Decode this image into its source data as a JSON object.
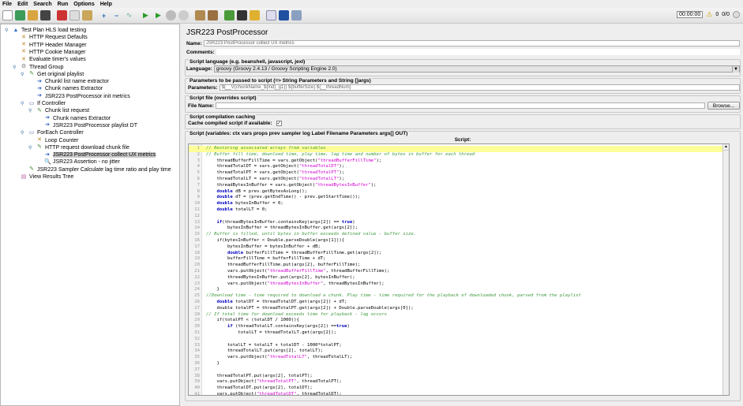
{
  "menu": [
    "File",
    "Edit",
    "Search",
    "Run",
    "Options",
    "Help"
  ],
  "toolbar": [
    "new-icon",
    "templates-icon",
    "open-icon",
    "save-icon",
    "cut-icon",
    "copy-icon",
    "paste-icon",
    "expand-icon",
    "collapse-icon",
    "toggle-icon",
    "start-icon",
    "start-no-pauses-icon",
    "stop-icon",
    "shutdown-icon",
    "clear-icon",
    "clear-all-icon",
    "function-helper-icon",
    "search-icon",
    "reset-search-icon",
    "help-icon",
    "log-viewer-icon",
    "remote-icon"
  ],
  "status": {
    "timer": "00:00:00",
    "warnings": "0",
    "threads": "0/0"
  },
  "tree": [
    {
      "label": "Test Plan HLS load testing",
      "level": 0,
      "icon": "test-plan-icon",
      "toggle": true
    },
    {
      "label": "HTTP Request Defaults",
      "level": 1,
      "icon": "config-icon"
    },
    {
      "label": "HTTP Header Manager",
      "level": 1,
      "icon": "config-icon"
    },
    {
      "label": "HTTP Cookie Manager",
      "level": 1,
      "icon": "config-icon"
    },
    {
      "label": "Evaluate timer's values",
      "level": 1,
      "icon": "config-icon"
    },
    {
      "label": "Thread Group",
      "level": 1,
      "icon": "thread-group-icon",
      "toggle": true
    },
    {
      "label": "Get original playlist",
      "level": 2,
      "icon": "sampler-icon",
      "toggle": true
    },
    {
      "label": "Chunkl list name extractor",
      "level": 3,
      "icon": "postprocessor-icon"
    },
    {
      "label": "Chunk names Extractor",
      "level": 3,
      "icon": "postprocessor-icon"
    },
    {
      "label": "JSR223 PostProcessor init metrics",
      "level": 3,
      "icon": "postprocessor-icon"
    },
    {
      "label": "If Controller",
      "level": 2,
      "icon": "controller-icon",
      "toggle": true
    },
    {
      "label": "Chunk list request",
      "level": 3,
      "icon": "sampler-icon",
      "toggle": true
    },
    {
      "label": "Chunk names Extractor",
      "level": 4,
      "icon": "postprocessor-icon"
    },
    {
      "label": "JSR223 PostProcessor playlist DT",
      "level": 4,
      "icon": "postprocessor-icon"
    },
    {
      "label": "ForEach Controller",
      "level": 2,
      "icon": "controller-icon",
      "toggle": true
    },
    {
      "label": "Loop Counter",
      "level": 3,
      "icon": "config-icon"
    },
    {
      "label": "HTTP request download chunk file",
      "level": 3,
      "icon": "sampler-icon",
      "toggle": true
    },
    {
      "label": "JSR223 PostProcessor collect UX metrics",
      "level": 4,
      "icon": "postprocessor-icon",
      "selected": true
    },
    {
      "label": "JSR223 Assertion - no jitter",
      "level": 4,
      "icon": "assertion-icon"
    },
    {
      "label": "JSR223 Sampler Calculate lag time ratio and play time",
      "level": 2,
      "icon": "sampler-icon"
    },
    {
      "label": "View Results Tree",
      "level": 1,
      "icon": "listener-icon"
    }
  ],
  "panel": {
    "title": "JSR223 PostProcessor",
    "name_label": "Name:",
    "name_value": "JSR223 PostProcessor collect UX metrics",
    "comments_label": "Comments:",
    "lang_group": "Script language (e.g. beanshell, javascript, jexl)",
    "lang_label": "Language:",
    "lang_value": "groovy     (Groovy 2.4.13 / Groovy Scripting Engine 2.0)",
    "params_group": "Parameters to be passed to script (=> String Parameters and String []args)",
    "params_label": "Parameters:",
    "params_value": "${__V(chunkName_${lnd}_g1)} ${bufferSize} ${__threadNum}",
    "file_group": "Script file (overrides script)",
    "file_label": "File Name:",
    "browse": "Browse...",
    "cache_group": "Script compilation caching",
    "cache_label": "Cache compiled script if available:",
    "cache_checked": true,
    "script_group": "Script (variables: ctx vars props prev sampler log Label Filename Parameters args[] OUT)",
    "script_label": "Script:"
  },
  "code": [
    "// Restoring associated arrays from variables",
    "// Buffer fill time, download time, play time, lag time and number of bytes in buffer for each thread",
    "    threadBufferFillTime = vars.getObject(\"threadBufferFillTime\");",
    "    threadTotalDT = vars.getObject(\"threadTotalDT\");",
    "    threadTotalPT = vars.getObject(\"threadTotalPT\");",
    "    threadTotalLT = vars.getObject(\"threadTotalLT\");",
    "    threadBytesInBuffer = vars.getObject(\"threadBytesInBuffer\");",
    "    double dB = prev.getBytesAsLong();",
    "    double dT = (prev.getEndTime() - prev.getStartTime());",
    "    double bytesInBuffer = 0;",
    "    double totalLT = 0;",
    "",
    "    if(threadBytesInBuffer.containsKey(args[2]) == true)",
    "        bytesInBuffer = threadBytesInBuffer.get(args[2]);",
    "// Buffer is filled, until bytes in buffer exceeds defined value - buffer size.",
    "    if(bytesInBuffer < Double.parseDouble(args[1])){",
    "        bytesInBuffer = bytesInBuffer + dB;",
    "        double bufferFillTime = threadBufferFillTime.get(args[2]);",
    "        bufferFillTime = bufferFillTime + dT;",
    "        threadBufferFillTime.put(args[2], bufferFillTime);",
    "        vars.putObject(\"threadBufferFillTime\", threadBufferFillTime);",
    "        threadBytesInBuffer.put(args[2], bytesInBuffer);",
    "        vars.putObject(\"threadBytesInBuffer\", threadBytesInBuffer);",
    "    }",
    "//Download time - time required to download a chunk. Play time - time required for the playback of downloaded chunk, parsed from the playlist",
    "    double totalDT = threadTotalDT.get(args[2]) + dT;",
    "    double totalPT = threadTotalPT.get(args[2]) + Double.parseDouble(args[0]);",
    "// If total time for download exceeds time for playback - lag occurs",
    "    if(totalPT < (totalDT / 1000)){",
    "        if (threadTotalLT.containsKey(args[2]) ==true)",
    "            totalLT = threadTotalLT.get(args[2]);",
    "",
    "        totalLT = totalLT + totalDT - 1000*totalPT;",
    "        threadTotalLT.put(args[2], totalLT);",
    "        vars.putObject(\"threadTotalLT\", threadTotalLT);",
    "    }",
    "",
    "    threadTotalPT.put(args[2], totalPT);",
    "    vars.putObject(\"threadTotalPT\", threadTotalPT);",
    "    threadTotalDT.put(args[2], totalDT);",
    "    vars.putObject(\"threadTotalDT\", threadTotalDT);"
  ]
}
